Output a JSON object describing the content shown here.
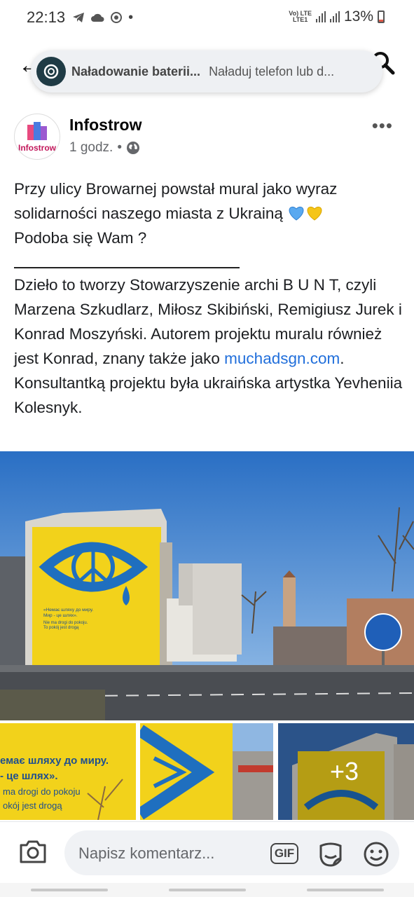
{
  "status_bar": {
    "time": "22:13",
    "network_top": "Vo) LTE",
    "network_bottom": "LTE1",
    "battery": "13%"
  },
  "notification": {
    "title": "Naładowanie baterii...",
    "text": "Naładuj telefon lub d..."
  },
  "post": {
    "author": "Infostrow",
    "avatar_text": "Infostrow",
    "time": "1 godz.",
    "separator": "•",
    "paragraph1": "Przy ulicy Browarnej powstał mural jako wyraz solidarności naszego miasta z Ukrainą",
    "paragraph1_end": "Podoba się Wam ?",
    "paragraph2_start": "Dzieło to tworzy Stowarzyszenie archi B U N T, czyli Marzena Szkudlarz, Miłosz Skibiński, Remigiusz Jurek i Konrad Moszyński. Autorem projektu muralu również jest Konrad, znany także jako ",
    "link": "muchadsgn.com",
    "paragraph2_end": ". Konsultantką projektu była ukraińska artystka Yevheniia Kolesnyk.",
    "heart_colors": [
      "#5aa9f0",
      "#f5c518"
    ]
  },
  "photos": {
    "mural_line1": "«Немає шляху до миру.",
    "mural_line2": "Мир - це шлях».",
    "mural_line3": "Nie ma drogi do pokoju.",
    "mural_line4": "To pokój jest drogą",
    "thumb1_line1": "емає шляху до миру.",
    "thumb1_line2": "- це шлях».",
    "thumb1_line3": "ma drogi do pokoju",
    "thumb1_line4": "okój jest drogą",
    "more_count": "+3"
  },
  "comment_bar": {
    "placeholder": "Napisz komentarz...",
    "gif_label": "GIF"
  },
  "colors": {
    "mural_yellow": "#f2d21b",
    "mural_blue": "#1f6fbf",
    "link_blue": "#216fdb"
  }
}
